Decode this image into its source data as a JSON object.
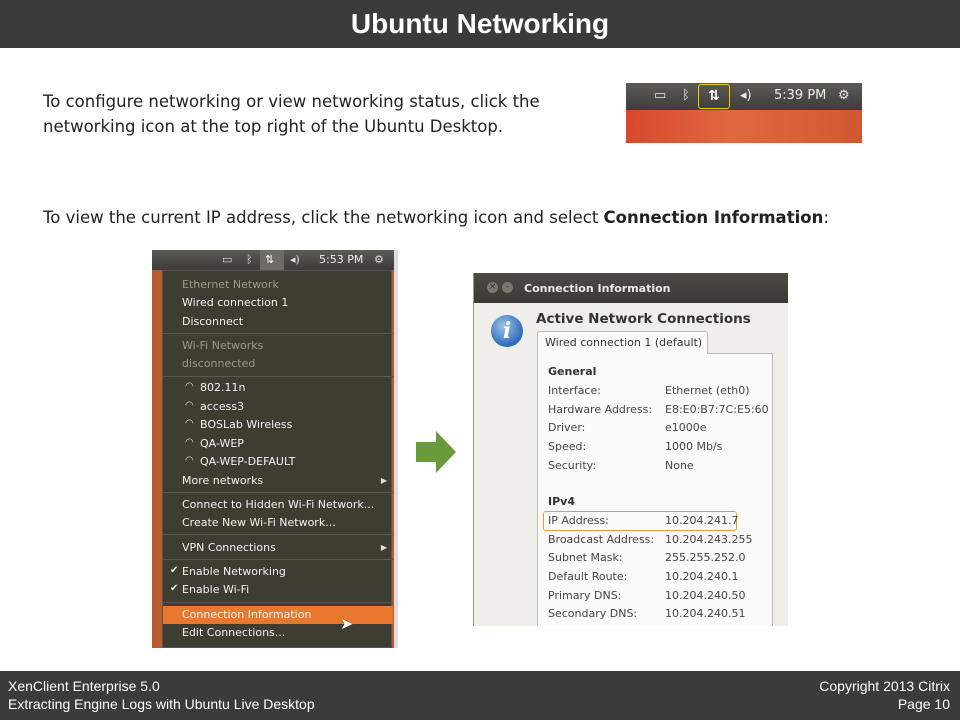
{
  "slide": {
    "title": "Ubuntu Networking"
  },
  "body": {
    "para1": "To configure networking or view networking status, click the networking icon at the top right of the Ubuntu Desktop.",
    "para2_prefix": "To view the current IP address, click the networking icon and select ",
    "para2_bold": "Connection Information",
    "para2_suffix": ":"
  },
  "panel_screenshot": {
    "time": "5:39 PM"
  },
  "menu_screenshot": {
    "time": "5:53 PM",
    "items": {
      "ethernet_network": "Ethernet Network",
      "wired_connection": "Wired connection 1",
      "disconnect": "Disconnect",
      "wifi_networks": "Wi-Fi Networks",
      "disconnected": "disconnected",
      "net1": "802.11n",
      "net2": "access3",
      "net3": "BOSLab Wireless",
      "net4": "QA-WEP",
      "net5": "QA-WEP-DEFAULT",
      "more_networks": "More networks",
      "connect_hidden": "Connect to Hidden Wi-Fi Network...",
      "create_new": "Create New Wi-Fi Network...",
      "vpn": "VPN Connections",
      "enable_networking": "Enable Networking",
      "enable_wifi": "Enable Wi-Fi",
      "connection_information": "Connection Information",
      "edit_connections": "Edit Connections..."
    }
  },
  "info_screenshot": {
    "window_title": "Connection Information",
    "heading": "Active Network Connections",
    "tab": "Wired connection 1 (default)",
    "general_label": "General",
    "general": [
      {
        "label": "Interface:",
        "value": "Ethernet (eth0)"
      },
      {
        "label": "Hardware Address:",
        "value": "E8:E0:B7:7C:E5:60"
      },
      {
        "label": "Driver:",
        "value": "e1000e"
      },
      {
        "label": "Speed:",
        "value": "1000 Mb/s"
      },
      {
        "label": "Security:",
        "value": "None"
      }
    ],
    "ipv4_label": "IPv4",
    "ipv4": [
      {
        "label": "IP Address:",
        "value": "10.204.241.7"
      },
      {
        "label": "Broadcast Address:",
        "value": "10.204.243.255"
      },
      {
        "label": "Subnet Mask:",
        "value": "255.255.252.0"
      },
      {
        "label": "Default Route:",
        "value": "10.204.240.1"
      },
      {
        "label": "Primary DNS:",
        "value": "10.204.240.50"
      },
      {
        "label": "Secondary DNS:",
        "value": "10.204.240.51"
      }
    ]
  },
  "footer": {
    "product": "XenClient Enterprise 5.0",
    "subtitle": "Extracting Engine Logs with Ubuntu Live Desktop",
    "copyright": "Copyright 2013 Citrix",
    "page": "Page 10"
  },
  "colors": {
    "bar": "#3b3b3b",
    "arrow": "#6a9a3a",
    "highlight": "#e9782e"
  }
}
